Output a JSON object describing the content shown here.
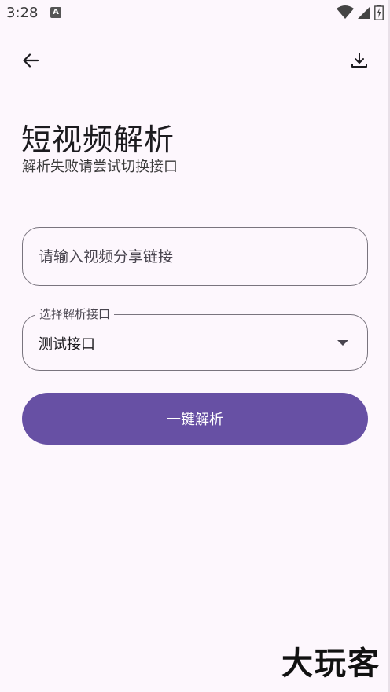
{
  "status_bar": {
    "time": "3:28",
    "notification_icon": "A"
  },
  "toolbar": {
    "back_icon": "arrow-left-icon",
    "download_icon": "download-icon"
  },
  "header": {
    "title": "短视频解析",
    "subtitle": "解析失败请尝试切换接口"
  },
  "form": {
    "link_input": {
      "placeholder": "请输入视频分享链接",
      "value": ""
    },
    "interface_select": {
      "label": "选择解析接口",
      "selected": "测试接口"
    },
    "parse_button_label": "一键解析"
  },
  "watermark": "大玩客",
  "colors": {
    "background": "#FDF7FD",
    "primary": "#6750A4",
    "outline": "#79747E"
  }
}
